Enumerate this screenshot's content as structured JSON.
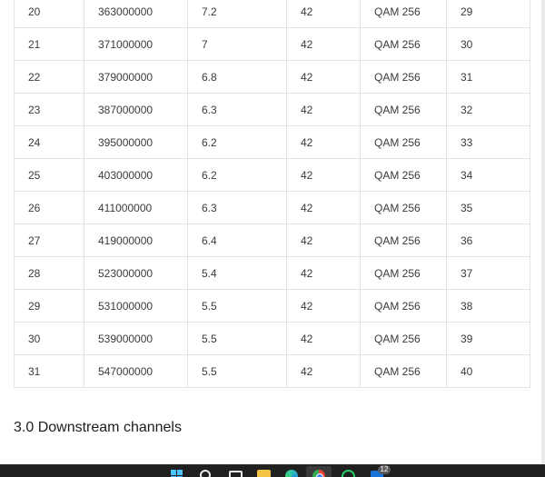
{
  "table": {
    "rows": [
      [
        "20",
        "363000000",
        "7.2",
        "42",
        "QAM 256",
        "29"
      ],
      [
        "21",
        "371000000",
        "7",
        "42",
        "QAM 256",
        "30"
      ],
      [
        "22",
        "379000000",
        "6.8",
        "42",
        "QAM 256",
        "31"
      ],
      [
        "23",
        "387000000",
        "6.3",
        "42",
        "QAM 256",
        "32"
      ],
      [
        "24",
        "395000000",
        "6.2",
        "42",
        "QAM 256",
        "33"
      ],
      [
        "25",
        "403000000",
        "6.2",
        "42",
        "QAM 256",
        "34"
      ],
      [
        "26",
        "411000000",
        "6.3",
        "42",
        "QAM 256",
        "35"
      ],
      [
        "27",
        "419000000",
        "6.4",
        "42",
        "QAM 256",
        "36"
      ],
      [
        "28",
        "523000000",
        "5.4",
        "42",
        "QAM 256",
        "37"
      ],
      [
        "29",
        "531000000",
        "5.5",
        "42",
        "QAM 256",
        "38"
      ],
      [
        "30",
        "539000000",
        "5.5",
        "42",
        "QAM 256",
        "39"
      ],
      [
        "31",
        "547000000",
        "5.5",
        "42",
        "QAM 256",
        "40"
      ]
    ]
  },
  "section": {
    "heading": "3.0 Downstream channels"
  },
  "taskbar": {
    "icons": [
      "windows-start-icon",
      "search-icon",
      "task-view-icon",
      "file-explorer-icon",
      "edge-browser-icon",
      "chrome-icon",
      "whatsapp-icon",
      "mail-icon"
    ],
    "active_app": "chrome-icon",
    "mail_badge": "12"
  },
  "colors": {
    "table_text": "#3a3a3a",
    "table_border": "#e4e4e4",
    "taskbar_bg": "#202020"
  }
}
